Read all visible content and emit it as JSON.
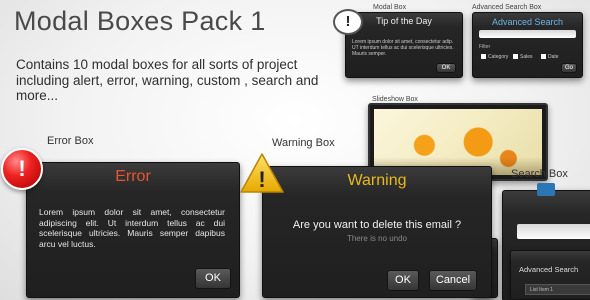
{
  "header": {
    "title": "Modal Boxes Pack 1",
    "intro": "Contains 10 modal boxes for all sorts of project including alert, error, warning, custom , search and more..."
  },
  "labels": {
    "modal_box": "Modal Box",
    "advanced_search_box": "Advanced Search Box",
    "slideshow_box": "Slideshow Box",
    "error_box": "Error Box",
    "warning_box": "Warning Box",
    "search_box": "Search Box"
  },
  "tip_modal": {
    "title": "Tip of the Day",
    "body": "Lorem ipsum dolor sit amet, consectetur adip. UT interdum tellus ac dui scelerisque ultricies. Mauris semper.",
    "ok_label": "OK",
    "icon_glyph": "!"
  },
  "advanced_search_modal": {
    "title": "Advanced Search",
    "filter_label": "Filter",
    "categories": [
      "Category",
      "Sales",
      "Date"
    ],
    "go_label": "Go"
  },
  "error_modal": {
    "title": "Error",
    "body": "Lorem ipsum dolor sit amet, consectetur adipiscing elit. Ut interdum tellus ac dui scelerisque ultricies. Mauris semper dapibus arcu vel luctus.",
    "ok_label": "OK",
    "icon_glyph": "!"
  },
  "warning_modal": {
    "title": "Warning",
    "question": "Are you want to delete this email ?",
    "subtext": "There is no undo",
    "ok_label": "OK",
    "cancel_label": "Cancel",
    "icon_glyph": "!"
  },
  "advanced_search_lower": {
    "title": "Advanced Search",
    "list_item": "List Item 1"
  },
  "colors": {
    "error_title": "#e8542e",
    "warning_title": "#e8b81e",
    "search_title": "#6ab4e8",
    "panel_bg": "#262626"
  },
  "icons": [
    "speech-bubble-icon",
    "error-icon",
    "warning-icon",
    "magnifier-icon"
  ]
}
